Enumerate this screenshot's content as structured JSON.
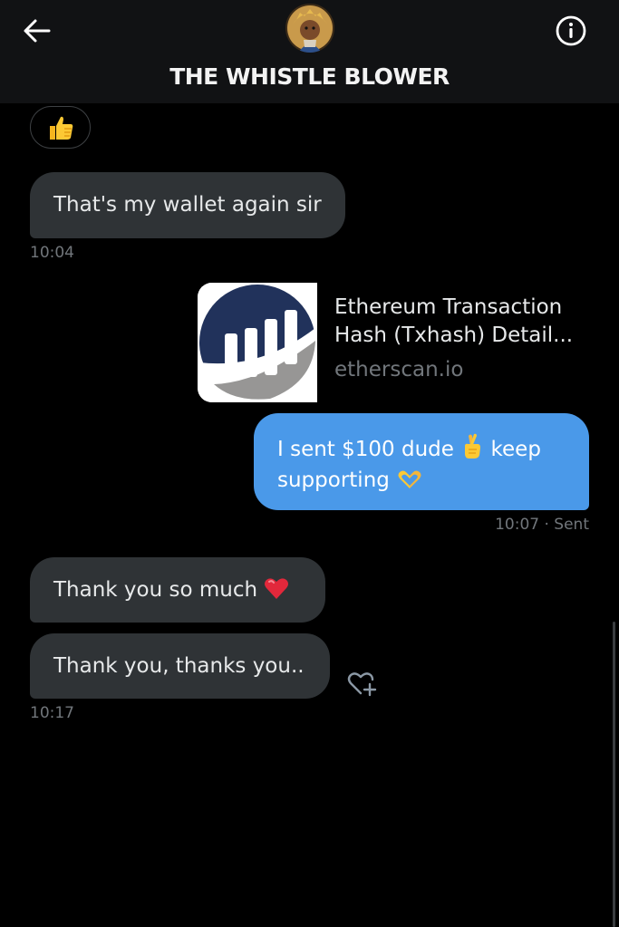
{
  "header": {
    "title": "THE WHISTLE BLOWER",
    "back_icon": "arrow-left-icon",
    "info_icon": "info-circle-icon",
    "avatar_icon": "profile-avatar"
  },
  "messages": [
    {
      "id": "reaction",
      "type": "reaction",
      "emoji": "thumbs-up-icon"
    },
    {
      "id": "m1",
      "direction": "incoming",
      "text": "That's my wallet again sir",
      "time": "10:04"
    },
    {
      "id": "m2",
      "direction": "outgoing",
      "type": "link-preview",
      "link": {
        "title": "Ethereum Transaction Hash (Txhash) Detail...",
        "domain": "etherscan.io",
        "thumb_icon": "etherscan-logo"
      }
    },
    {
      "id": "m3",
      "direction": "outgoing",
      "text_line1_a": "I sent  $100 dude ",
      "text_line1_b": "  keep",
      "text_line2": "supporting ",
      "emojis": [
        "crossed-fingers-icon",
        "heart-hands-icon"
      ],
      "time": "10:07",
      "status": "· Sent"
    },
    {
      "id": "m4",
      "direction": "incoming",
      "text": "Thank you so much ",
      "emoji": "red-heart-icon"
    },
    {
      "id": "m5",
      "direction": "incoming",
      "text": "Thank you, thanks you..",
      "time": "10:17",
      "reaction_add_icon": "heart-plus-icon"
    }
  ],
  "colors": {
    "background": "#000000",
    "header": "#111214",
    "incoming_bubble": "#2f3336",
    "outgoing_bubble": "#4a99e9",
    "muted_text": "#71767b"
  }
}
